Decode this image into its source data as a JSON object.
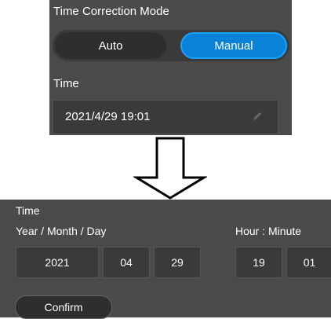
{
  "top_panel": {
    "title": "Time Correction Mode",
    "mode_options": [
      "Auto",
      "Manual"
    ],
    "selected_mode": "Manual",
    "time_label": "Time",
    "time_value": "2021/4/29 19:01"
  },
  "bottom_panel": {
    "title": "Time",
    "date_label": "Year / Month / Day",
    "time_label": "Hour : Minute",
    "year": "2021",
    "month": "04",
    "day": "29",
    "hour": "19",
    "minute": "01",
    "confirm_label": "Confirm"
  },
  "colors": {
    "panel_bg": "#4a4a4a",
    "field_bg": "#3a3a3a",
    "accent": "#0a82d8"
  }
}
